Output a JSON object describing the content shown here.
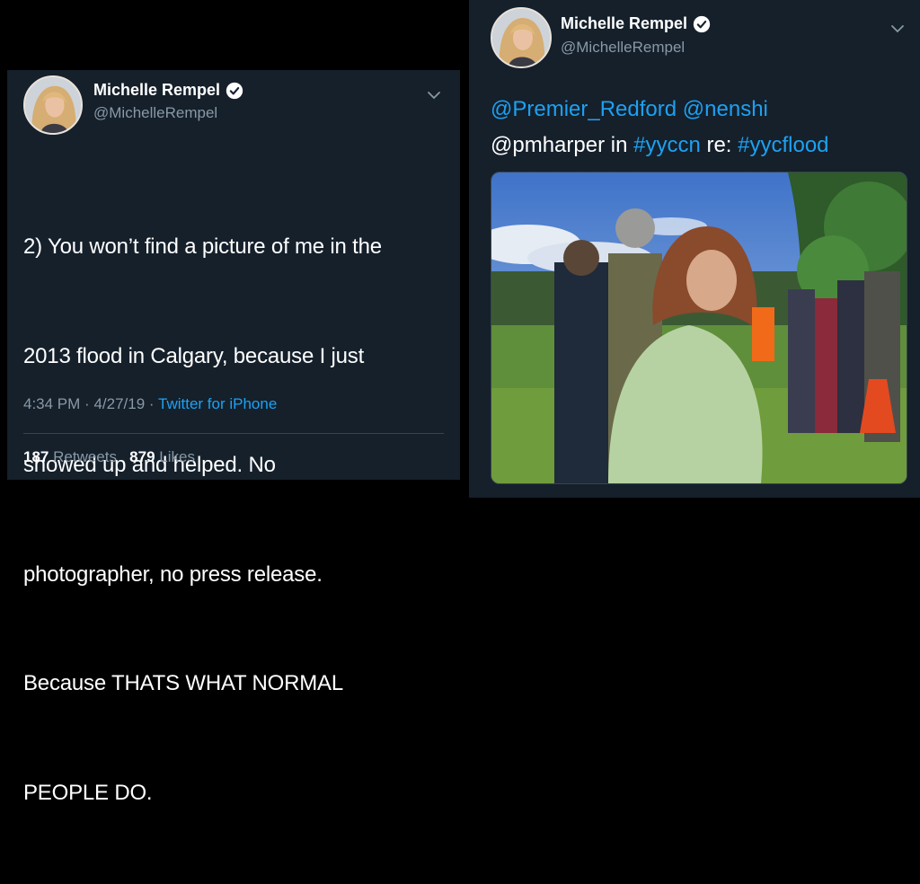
{
  "left_tweet": {
    "display_name": "Michelle Rempel",
    "handle": "@MichelleRempel",
    "lines": [
      "2) You won’t find a picture of me in the",
      "2013 flood in Calgary, because I just",
      "showed up and helped. No",
      "photographer, no press release.",
      "Because THATS WHAT NORMAL",
      "PEOPLE DO."
    ],
    "time": "4:34 PM",
    "date": "4/27/19",
    "separator": "·",
    "client": "Twitter for iPhone",
    "retweets_count": "187",
    "retweets_label": "Retweets",
    "likes_count": "879",
    "likes_label": "Likes"
  },
  "right_tweet": {
    "display_name": "Michelle Rempel",
    "handle": "@MichelleRempel",
    "line1_mention1": "@Premier_Redford",
    "line1_mention2": "@nenshi",
    "line2_handle": "@pmharper",
    "line2_in": " in ",
    "line2_hashtag1": "#yyccn",
    "line2_re": " re: ",
    "line2_hashtag2": "#yycflood"
  },
  "icons": {
    "verified": "verified-badge-icon",
    "chevron": "chevron-down-icon"
  },
  "colors": {
    "background": "#15202b",
    "link": "#1da1f2",
    "secondary": "#8899a6"
  }
}
